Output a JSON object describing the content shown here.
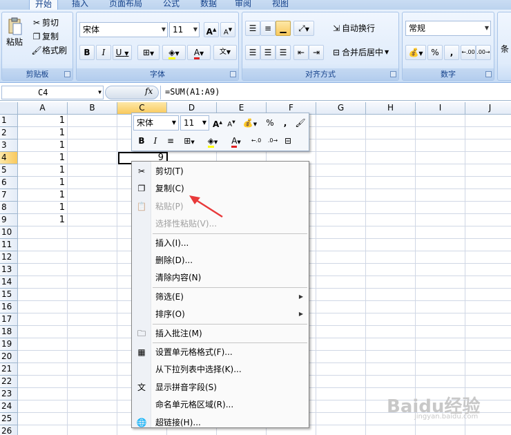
{
  "ribbon": {
    "tabs": [
      "开始",
      "插入",
      "页面布局",
      "公式",
      "数据",
      "审阅",
      "视图"
    ],
    "clipboard": {
      "paste": "粘贴",
      "cut": "剪切",
      "copy": "复制",
      "format_painter": "格式刷",
      "label": "剪贴板"
    },
    "font": {
      "name": "宋体",
      "size": "11",
      "label": "字体",
      "bold": "B",
      "italic": "I",
      "underline": "U",
      "grow": "A",
      "shrink": "A",
      "phonetic": "文"
    },
    "alignment": {
      "wrap": "自动换行",
      "merge": "合并后居中",
      "label": "对齐方式"
    },
    "number": {
      "format": "常规",
      "percent": "%",
      "comma": ",",
      "label": "数字"
    },
    "cut_partial": "条"
  },
  "formula_bar": {
    "name_box": "C4",
    "fx": "fx",
    "formula": "=SUM(A1:A9)"
  },
  "grid": {
    "columns": [
      "A",
      "B",
      "C",
      "D",
      "E",
      "F",
      "G",
      "H",
      "I",
      "J"
    ],
    "rows": [
      "1",
      "2",
      "3",
      "4",
      "5",
      "6",
      "7",
      "8",
      "9",
      "10",
      "11",
      "12",
      "13",
      "14",
      "15",
      "16",
      "17",
      "18",
      "19",
      "20",
      "21",
      "22",
      "23",
      "24",
      "25",
      "26"
    ],
    "column_a_values": [
      "1",
      "1",
      "1",
      "1",
      "1",
      "1",
      "1",
      "1",
      "1"
    ],
    "c4_value": "9"
  },
  "mini_toolbar": {
    "font": "宋体",
    "size": "11",
    "percent": "%",
    "comma": ","
  },
  "context_menu": {
    "items": [
      {
        "label": "剪切(T)",
        "icon": "scissors-icon"
      },
      {
        "label": "复制(C)",
        "icon": "copy-icon"
      },
      {
        "label": "粘贴(P)",
        "icon": "paste-icon",
        "disabled": true
      },
      {
        "label": "选择性粘贴(V)...",
        "disabled": true
      },
      {
        "label": "插入(I)..."
      },
      {
        "label": "删除(D)..."
      },
      {
        "label": "清除内容(N)"
      },
      {
        "label": "筛选(E)",
        "submenu": true
      },
      {
        "label": "排序(O)",
        "submenu": true
      },
      {
        "label": "插入批注(M)",
        "icon": "comment-icon"
      },
      {
        "label": "设置单元格格式(F)...",
        "icon": "format-cells-icon"
      },
      {
        "label": "从下拉列表中选择(K)..."
      },
      {
        "label": "显示拼音字段(S)",
        "icon": "phonetic-icon"
      },
      {
        "label": "命名单元格区域(R)..."
      },
      {
        "label": "超链接(H)...",
        "icon": "hyperlink-icon"
      }
    ]
  },
  "watermark": {
    "text": "Baidu经验",
    "sub": "jingyan.baidu.com"
  },
  "colors": {
    "accent": "#15428b",
    "selected_header": "#f9c95c",
    "arrow": "#e8393a"
  }
}
